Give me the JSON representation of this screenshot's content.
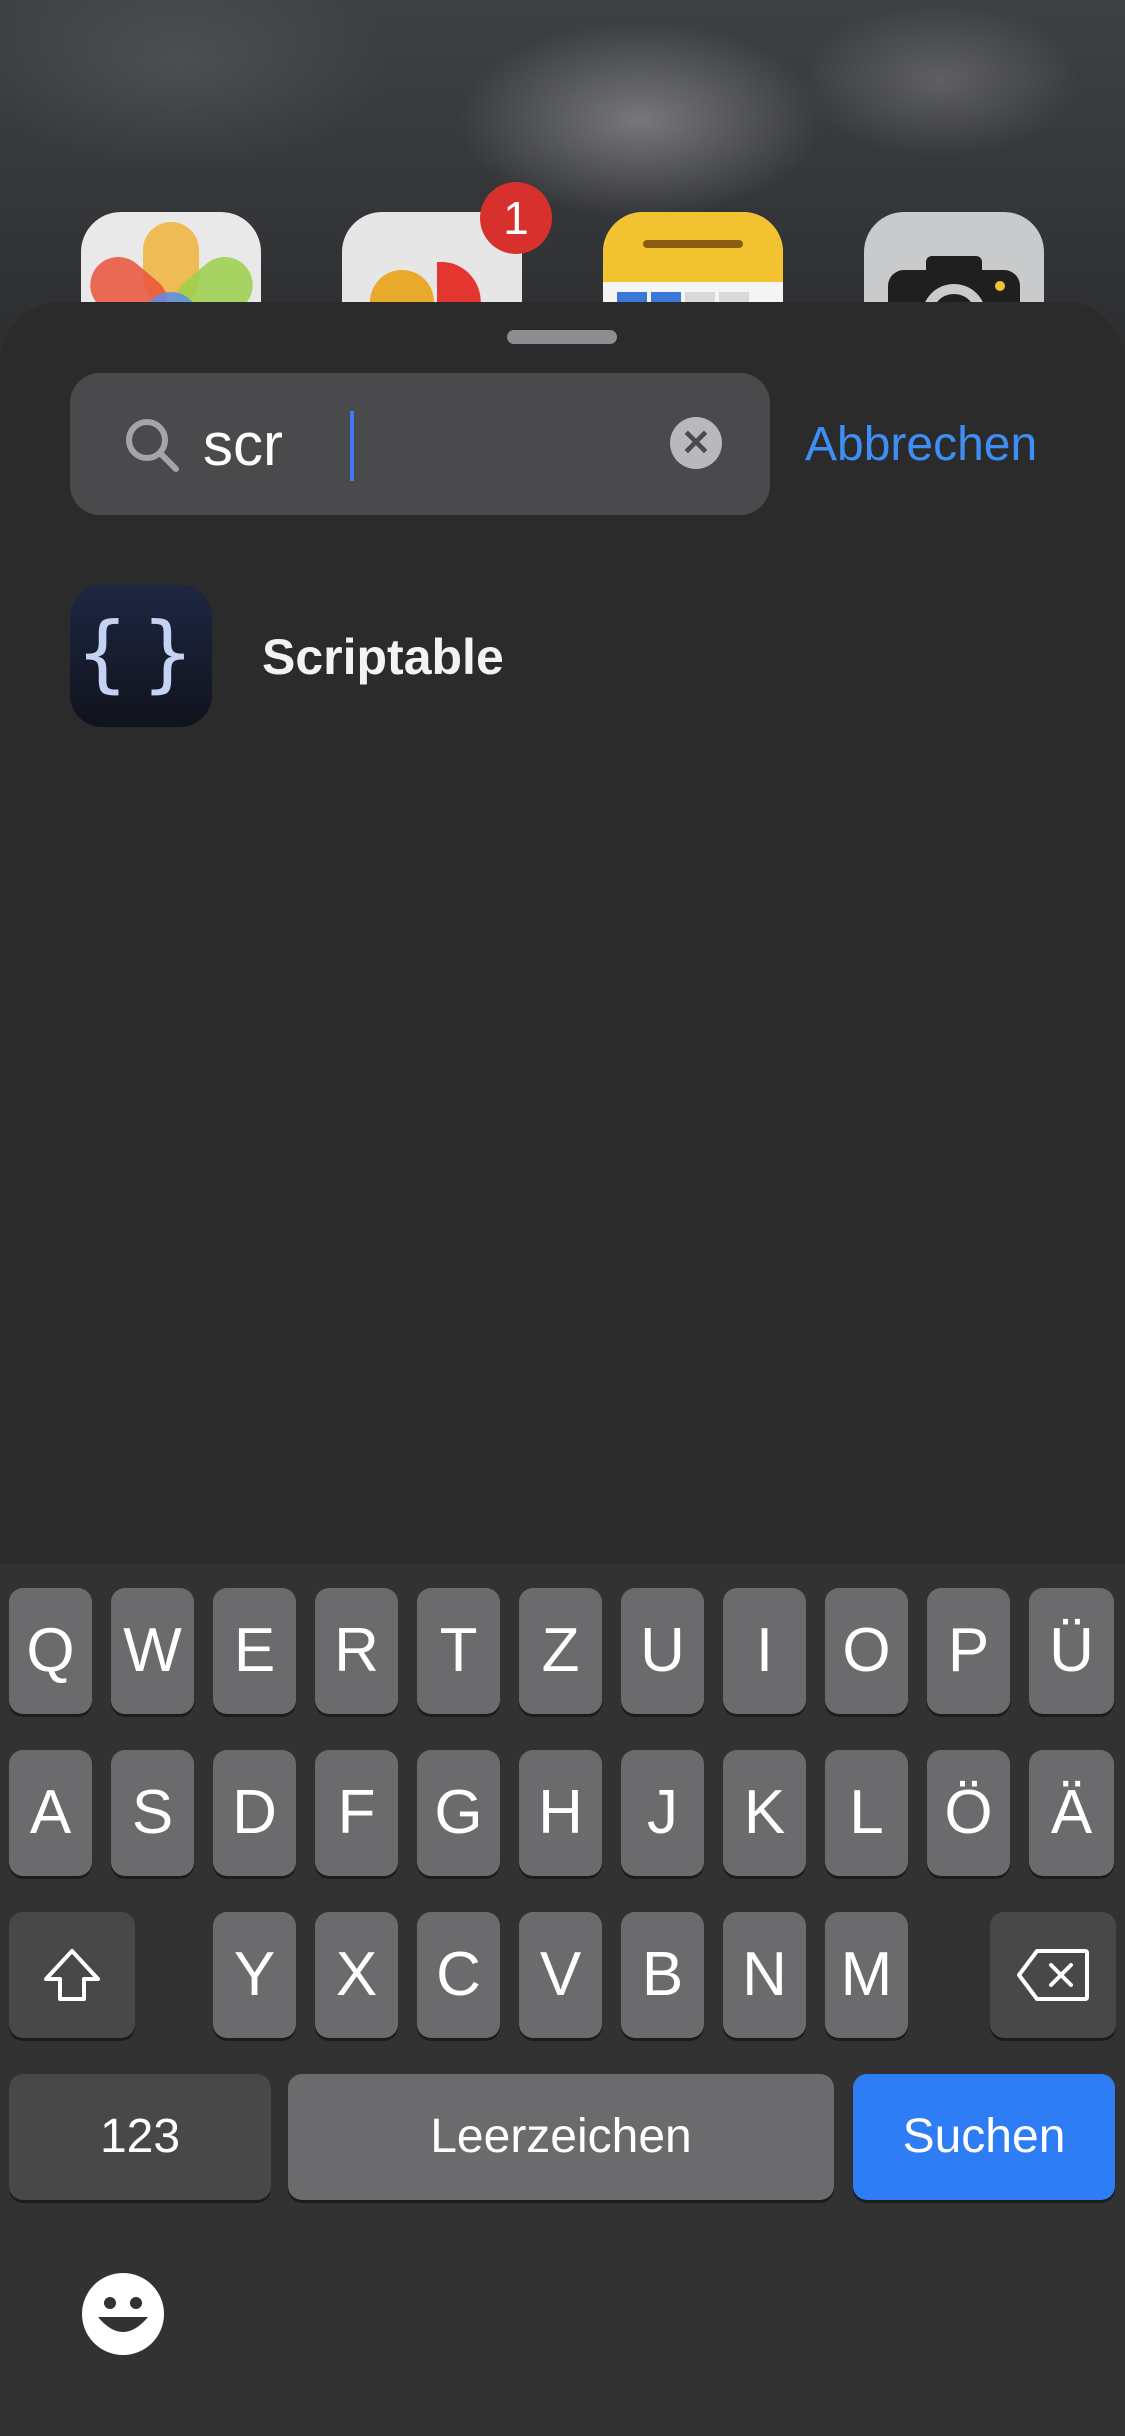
{
  "search": {
    "value": "scr",
    "cancel_label": "Abbrechen",
    "clear_symbol": "✕"
  },
  "results": [
    {
      "name": "Scriptable",
      "icon": "curly-braces-icon",
      "icon_glyph": "{}"
    }
  ],
  "home_icons": {
    "badge_count": "1"
  },
  "keyboard": {
    "row1": [
      "Q",
      "W",
      "E",
      "R",
      "T",
      "Z",
      "U",
      "I",
      "O",
      "P",
      "Ü"
    ],
    "row2": [
      "A",
      "S",
      "D",
      "F",
      "G",
      "H",
      "J",
      "K",
      "L",
      "Ö",
      "Ä"
    ],
    "row3": [
      "Y",
      "X",
      "C",
      "V",
      "B",
      "N",
      "M"
    ],
    "numbers_label": "123",
    "space_label": "Leerzeichen",
    "return_label": "Suchen",
    "shift_icon": "shift-arrow-icon",
    "delete_icon": "backspace-icon",
    "emoji_icon": "smiley-face-icon"
  },
  "colors": {
    "accent_blue": "#3f8ef6",
    "return_key_blue": "#2f7df5",
    "badge_red": "#d8312d",
    "sheet_background": "#2b2b2c"
  }
}
